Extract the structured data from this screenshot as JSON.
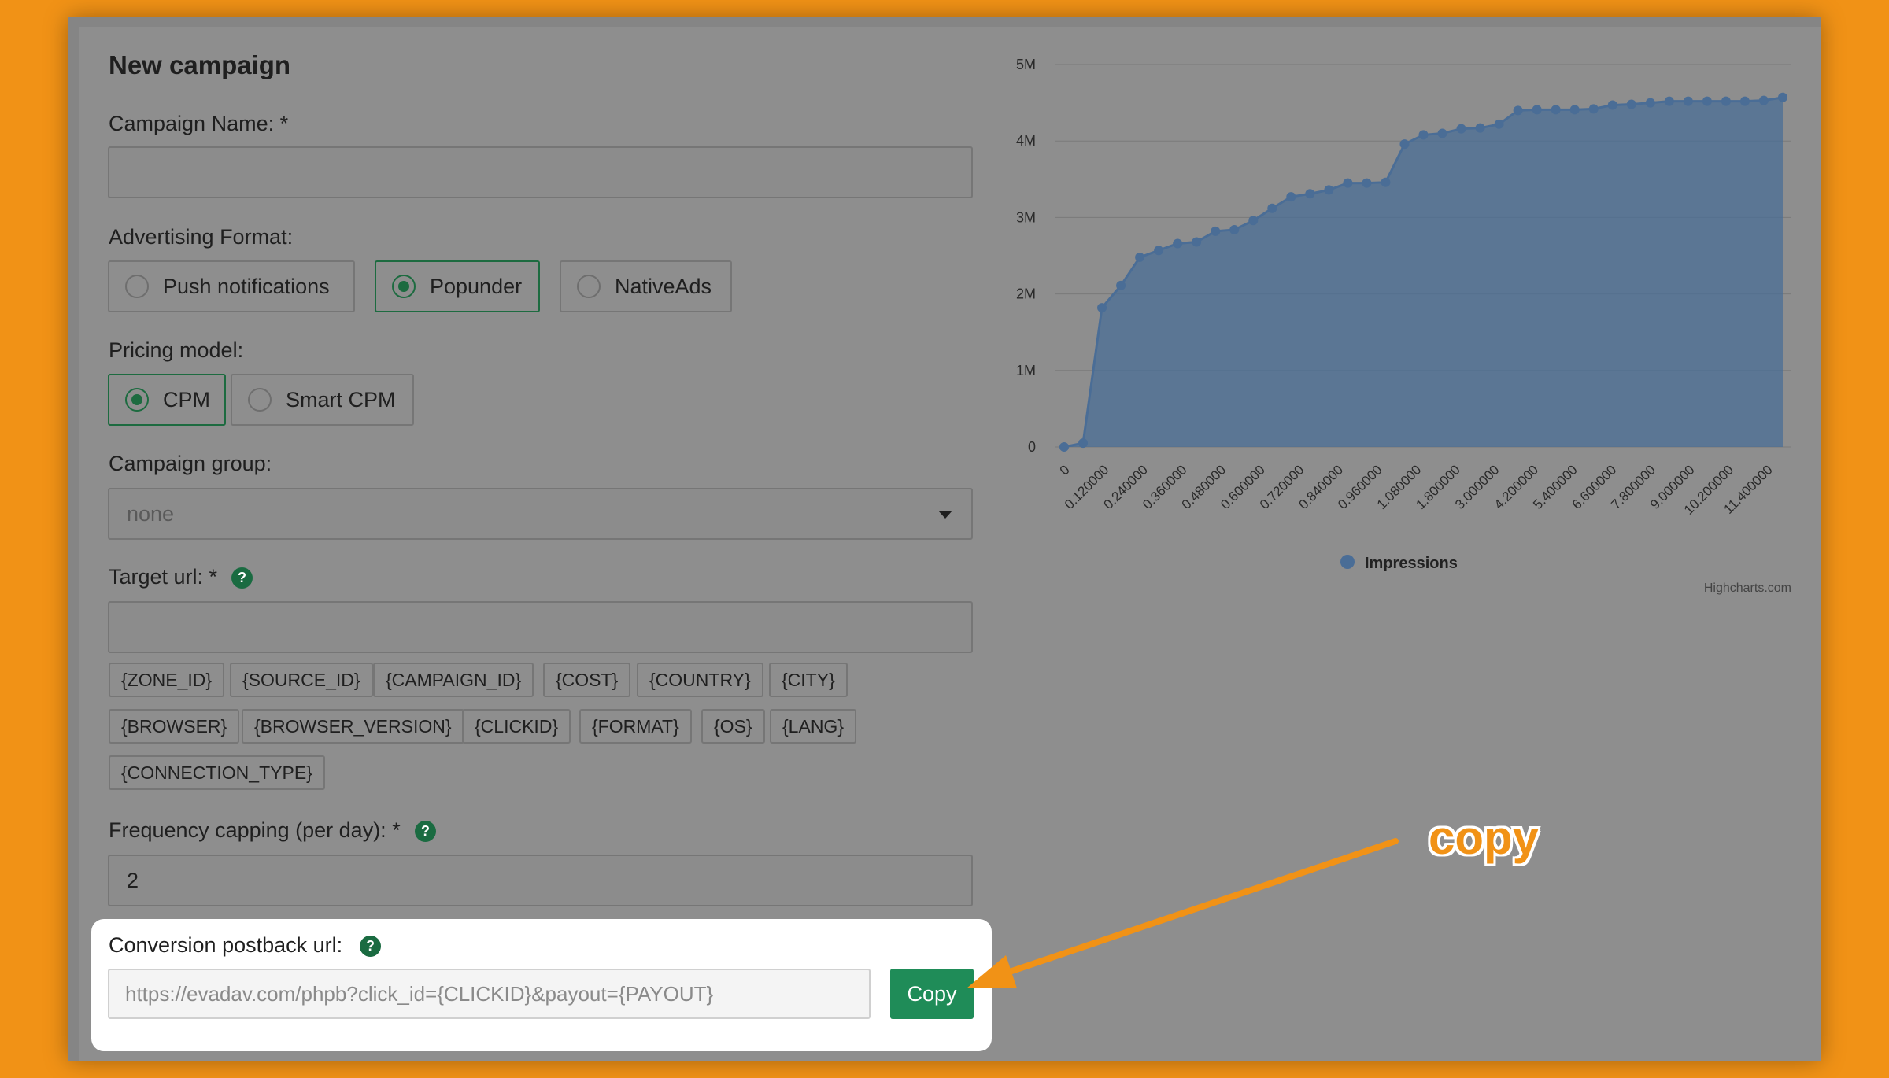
{
  "form": {
    "title": "New campaign",
    "campaign_name_label": "Campaign Name: *",
    "campaign_name_value": "",
    "ad_format_label": "Advertising Format:",
    "ad_formats": [
      {
        "label": "Push notifications",
        "selected": false
      },
      {
        "label": "Popunder",
        "selected": true
      },
      {
        "label": "NativeAds",
        "selected": false
      }
    ],
    "pricing_label": "Pricing model:",
    "pricing_models": [
      {
        "label": "CPM",
        "selected": true
      },
      {
        "label": "Smart CPM",
        "selected": false
      }
    ],
    "group_label": "Campaign group:",
    "group_value": "none",
    "target_url_label": "Target url: *",
    "target_url_value": "",
    "help_glyph": "?",
    "macros": [
      "{ZONE_ID}",
      "{SOURCE_ID}",
      "{CAMPAIGN_ID}",
      "{COST}",
      "{COUNTRY}",
      "{CITY}",
      "{BROWSER}",
      "{BROWSER_VERSION}",
      "{CLICKID}",
      "{FORMAT}",
      "{OS}",
      "{LANG}",
      "{CONNECTION_TYPE}"
    ],
    "frequency_label": "Frequency capping (per day): *",
    "frequency_value": "2",
    "postback_label": "Conversion postback url:",
    "postback_value": "https://evadav.com/phpb?click_id={CLICKID}&payout={PAYOUT}",
    "copy_label": "Copy"
  },
  "annotation": {
    "text": "copy",
    "color": "#f19216"
  },
  "colors": {
    "accent": "#1f8c58",
    "series": "#4a6d96",
    "background": "#f19216"
  },
  "chart_data": {
    "type": "area",
    "title": "",
    "xlabel": "",
    "ylabel": "",
    "y_ticks": [
      "0",
      "1M",
      "2M",
      "3M",
      "4M",
      "5M"
    ],
    "ylim": [
      0,
      5000000
    ],
    "x_labels": [
      "0",
      "0.120000",
      "0.240000",
      "0.360000",
      "0.480000",
      "0.600000",
      "0.720000",
      "0.840000",
      "0.960000",
      "1.080000",
      "1.800000",
      "3.000000",
      "4.200000",
      "5.400000",
      "6.600000",
      "7.800000",
      "9.000000",
      "10.200000",
      "11.400000"
    ],
    "grid": true,
    "legend": "bottom-center",
    "credit": "Highcharts.com",
    "series": [
      {
        "name": "Impressions",
        "color": "#4a6d96",
        "values": [
          0,
          50000,
          1820000,
          2110000,
          2480000,
          2570000,
          2660000,
          2680000,
          2820000,
          2840000,
          2960000,
          3120000,
          3270000,
          3310000,
          3360000,
          3450000,
          3450000,
          3460000,
          3960000,
          4080000,
          4100000,
          4160000,
          4170000,
          4220000,
          4400000,
          4410000,
          4410000,
          4410000,
          4420000,
          4470000,
          4480000,
          4500000,
          4520000,
          4520000,
          4520000,
          4520000,
          4520000,
          4530000,
          4570000
        ]
      }
    ]
  }
}
